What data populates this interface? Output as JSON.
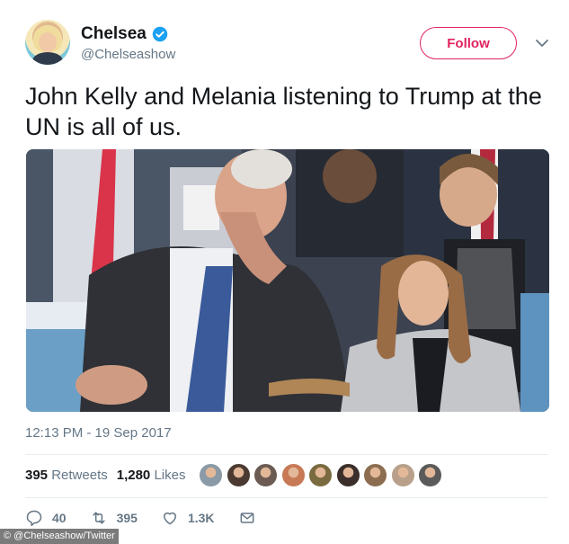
{
  "user": {
    "display_name": "Chelsea",
    "handle": "@Chelseashow",
    "verified": true,
    "avatar": "avatar-photo"
  },
  "follow_button": {
    "label": "Follow"
  },
  "menu_icon": "chevron-down-icon",
  "tweet": {
    "text": "John Kelly and Melania listening to Trump at the UN is all of us.",
    "media": "photo-un-assembly",
    "timestamp": "12:13 PM - 19 Sep 2017"
  },
  "stats": {
    "retweets_count": "395",
    "retweets_label": "Retweets",
    "likes_count": "1,280",
    "likes_label": "Likes",
    "liker_avatars": [
      "#8a9aa6",
      "#4a3a32",
      "#6b5b52",
      "#c77a55",
      "#7a6a3f",
      "#3a2f2a",
      "#8c6d4f",
      "#b8a08a",
      "#5a5a5a"
    ]
  },
  "actions": {
    "replies": "40",
    "retweets": "395",
    "likes": "1.3K",
    "message_icon": "envelope-icon"
  },
  "credit": "© @Chelseashow/Twitter",
  "colors": {
    "accent": "#e0245e",
    "verified": "#1da1f2",
    "muted": "#657786",
    "text": "#14171a"
  }
}
